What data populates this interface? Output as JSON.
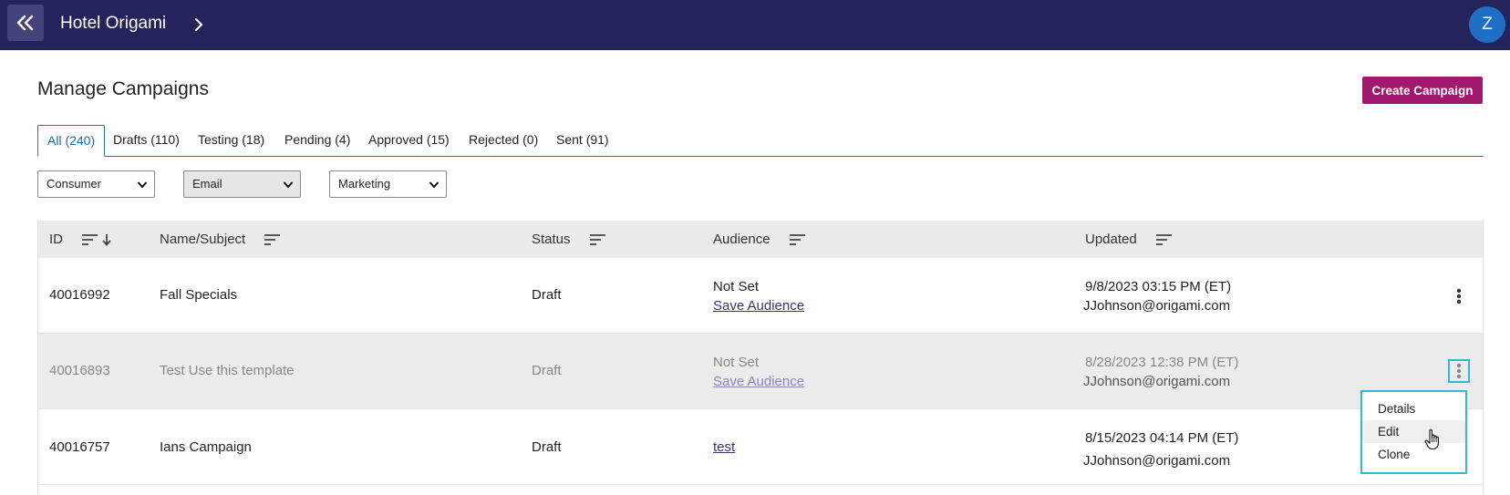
{
  "header": {
    "app_title": "Hotel Origami",
    "avatar_initial": "Z"
  },
  "page": {
    "title": "Manage Campaigns",
    "create_label": "Create Campaign"
  },
  "tabs": [
    {
      "label": "All (240)",
      "active": true
    },
    {
      "label": "Drafts (110)"
    },
    {
      "label": "Testing (18)"
    },
    {
      "label": "Pending (4)"
    },
    {
      "label": "Approved (15)"
    },
    {
      "label": "Rejected (0)"
    },
    {
      "label": "Sent (91)"
    }
  ],
  "filters": {
    "segment": "Consumer",
    "channel": "Email",
    "type": "Marketing"
  },
  "table": {
    "columns": {
      "id": "ID",
      "name": "Name/Subject",
      "status": "Status",
      "audience": "Audience",
      "updated": "Updated"
    },
    "rows": [
      {
        "id": "40016992",
        "name": "Fall Specials",
        "status": "Draft",
        "audience_status": "Not Set",
        "audience_link": "Save Audience",
        "updated_date": "9/8/2023 03:15 PM (ET)",
        "updated_by": "JJohnson@origami.com"
      },
      {
        "id": "40016893",
        "name": "Test Use this template",
        "status": "Draft",
        "audience_status": "Not Set",
        "audience_link": "Save Audience",
        "updated_date": "8/28/2023 12:38 PM (ET)",
        "updated_by": "JJohnson@origami.com"
      },
      {
        "id": "40016757",
        "name": "Ians Campaign",
        "status": "Draft",
        "audience_link": "test",
        "updated_date": "8/15/2023 04:14 PM (ET)",
        "updated_by": "JJohnson@origami.com"
      }
    ]
  },
  "row_menu": {
    "items": [
      "Details",
      "Edit",
      "Clone"
    ],
    "hovered": "Edit"
  },
  "colors": {
    "topbar": "#25235c",
    "accent": "#a0176c",
    "focus": "#34b8d0",
    "link": "#3a3575",
    "active_tab": "#1e68ad"
  }
}
